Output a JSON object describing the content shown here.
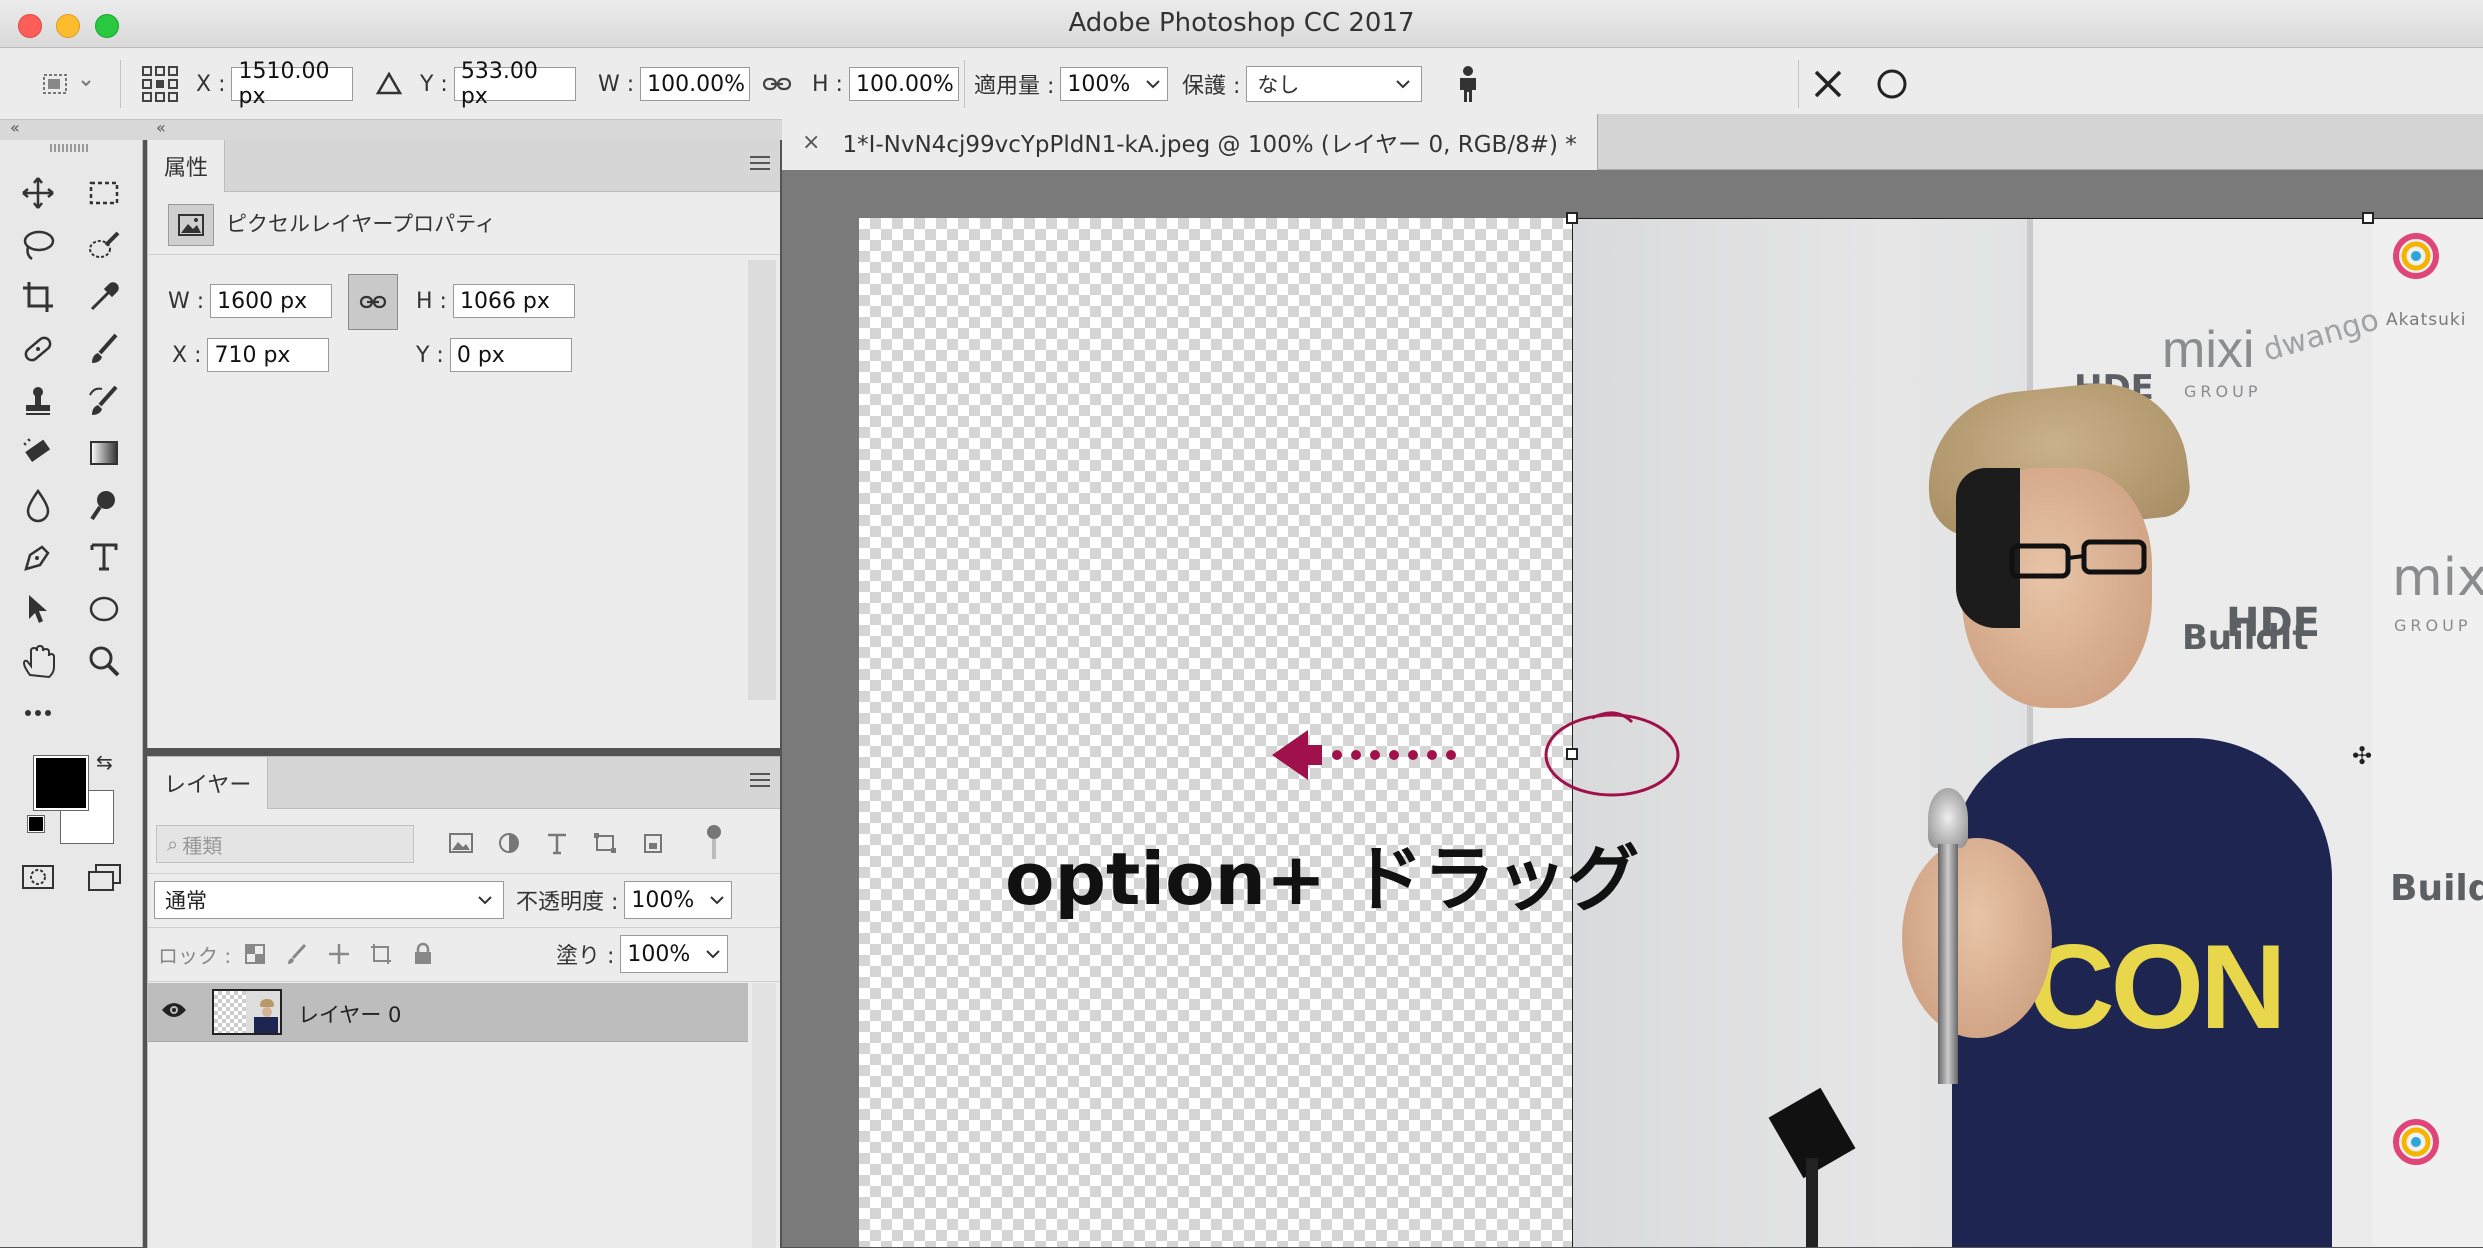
{
  "window": {
    "title": "Adobe Photoshop CC 2017"
  },
  "options_bar": {
    "x_label": "X :",
    "x_value": "1510.00 px",
    "y_label": "Y :",
    "y_value": "533.00 px",
    "w_label": "W :",
    "w_value": "100.00%",
    "h_label": "H :",
    "h_value": "100.00%",
    "amount_label": "適用量 :",
    "amount_value": "100%",
    "protect_label": "保護 :",
    "protect_value": "なし"
  },
  "properties_panel": {
    "tab": "属性",
    "section_title": "ピクセルレイヤープロパティ",
    "w_label": "W :",
    "w_value": "1600 px",
    "h_label": "H :",
    "h_value": "1066 px",
    "x_label": "X :",
    "x_value": "710 px",
    "y_label": "Y :",
    "y_value": "0 px"
  },
  "layers_panel": {
    "tab": "レイヤー",
    "search_placeholder": "種類",
    "blend_mode": "通常",
    "opacity_label": "不透明度 :",
    "opacity_value": "100%",
    "lock_label": "ロック :",
    "fill_label": "塗り :",
    "fill_value": "100%",
    "layers": [
      {
        "name": "レイヤー 0",
        "visible": true
      }
    ]
  },
  "document": {
    "tab_title": "1*I-NvN4cj99vcYpPldN1-kA.jpeg @ 100% (レイヤー 0, RGB/8#) *"
  },
  "annotation": {
    "text": "option+ ドラッグ",
    "color": "#a0114c"
  },
  "photo_text": {
    "mixi": "mixi",
    "group": "GROUP",
    "hde": "HDE",
    "dwango": "dwango",
    "akatsuki": "Akatsuki",
    "buildit": "BuildIt",
    "tshirt": "CON"
  },
  "colors": {
    "foreground": "#000000",
    "background": "#ffffff"
  },
  "icons": [
    "move-icon",
    "marquee-icon",
    "lasso-icon",
    "quick-select-icon",
    "crop-icon",
    "eyedropper-icon",
    "healing-icon",
    "brush-icon",
    "stamp-icon",
    "history-brush-icon",
    "eraser-icon",
    "gradient-icon",
    "blur-icon",
    "dodge-icon",
    "pen-icon",
    "type-icon",
    "path-select-icon",
    "ellipse-icon",
    "hand-icon",
    "zoom-icon",
    "more-icon"
  ]
}
